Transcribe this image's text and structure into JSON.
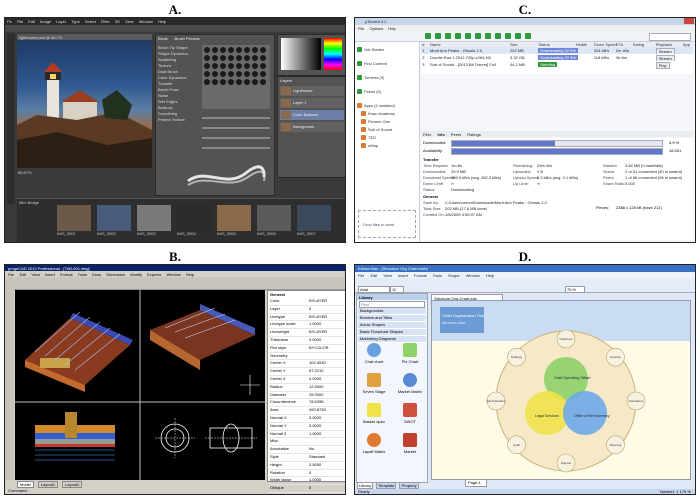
{
  "labels": {
    "a": "A.",
    "b": "B.",
    "c": "C.",
    "d": "D."
  },
  "panelA": {
    "menu": [
      "Ps",
      "File",
      "Edit",
      "Image",
      "Layer",
      "Type",
      "Select",
      "Filter",
      "3D",
      "View",
      "Window",
      "Help"
    ],
    "doc_tab": "lighthouse.psd @ 66.7%",
    "brush_tabs": [
      "Brush",
      "Brush Presets"
    ],
    "brush_options": [
      "Brush Tip Shape",
      "Shape Dynamics",
      "Scattering",
      "Texture",
      "Dual Brush",
      "Color Dynamics",
      "Transfer",
      "Brush Pose",
      "Noise",
      "Wet Edges",
      "Build-up",
      "Smoothing",
      "Protect Texture"
    ],
    "layers_title": "Layers",
    "layers": [
      "Lighthouse",
      "Layer 1",
      "Color Balance",
      "Background"
    ],
    "status": "66.67%",
    "mini_bridge": "Mini Bridge",
    "thumbs": [
      "IMG_0001",
      "IMG_0002",
      "IMG_0003",
      "IMG_0004",
      "IMG_0005",
      "IMG_0006",
      "IMG_0007"
    ]
  },
  "panelB": {
    "title": "progeCAD 2010 Professional - [TAB-001.dwg]",
    "menu": [
      "File",
      "Edit",
      "View",
      "Insert",
      "Format",
      "Tools",
      "Draw",
      "Dimension",
      "Modify",
      "Express",
      "Window",
      "Help"
    ],
    "props_title": "General",
    "props": [
      [
        "Color",
        "BYLAYER"
      ],
      [
        "Layer",
        "0"
      ],
      [
        "Linetype",
        "BYLAYER"
      ],
      [
        "Linetype scale",
        "1.0000"
      ],
      [
        "Lineweight",
        "BYLAYER"
      ],
      [
        "Thickness",
        "0.0000"
      ],
      [
        "Plot style",
        "BYCOLOR"
      ],
      [
        "Geometry",
        ""
      ],
      [
        "Center X",
        "102.4530"
      ],
      [
        "Center Y",
        "87.2210"
      ],
      [
        "Center Z",
        "0.0000"
      ],
      [
        "Radius",
        "12.5000"
      ],
      [
        "Diameter",
        "25.0000"
      ],
      [
        "Circumference",
        "78.5398"
      ],
      [
        "Area",
        "490.8739"
      ],
      [
        "Normal X",
        "0.0000"
      ],
      [
        "Normal Y",
        "0.0000"
      ],
      [
        "Normal Z",
        "1.0000"
      ],
      [
        "Misc",
        ""
      ],
      [
        "Annotative",
        "No"
      ],
      [
        "Style",
        "Standard"
      ],
      [
        "Height",
        "2.5000"
      ],
      [
        "Rotation",
        "0"
      ],
      [
        "Width factor",
        "1.0000"
      ],
      [
        "Oblique",
        "0"
      ],
      [
        "Justify",
        "Left"
      ]
    ],
    "tabs": [
      "Model",
      "Layout1",
      "Layout2"
    ],
    "command": "Command:"
  },
  "panelC": {
    "title": "µTorrent 3.2",
    "menu": [
      "File",
      "Options",
      "Help"
    ],
    "sidebar": [
      "Get Started",
      "Find Content",
      "Torrents (3)",
      "Feeds (0)",
      "Apps (4 installed)",
      "Khan Academy",
      "Pioneer One",
      "Sub of Sound",
      "TED",
      "uMap"
    ],
    "drop_text": "Drop files to send",
    "columns": [
      "#",
      "Name",
      "Size",
      "Status",
      "Health",
      "Down Speed",
      "ETA",
      "Rating",
      "Playback",
      "App"
    ],
    "torrents": [
      [
        "1",
        "Mont Ann Peaks - Ghosts 2.0",
        "202 MB",
        "Downloading 52.5%",
        "",
        "324 kB/s",
        "2m 40s",
        "",
        "Stream",
        ""
      ],
      [
        "2",
        "Doodle.Run.1.2012.720p.x264-HD",
        "3.32 GB",
        "Downloading 22.3%",
        "",
        "118 kB/s",
        "4h 8m",
        "",
        "Stream",
        ""
      ],
      [
        "3",
        "Sub of Sound - [2013 Bit Torrent] Full",
        "44.2 MB",
        "Seeding",
        "",
        "",
        "",
        "",
        "Play",
        ""
      ]
    ],
    "detail_tabs": [
      "Files",
      "Info",
      "Peers",
      "Ratings"
    ],
    "downloaded_label": "Downloaded:",
    "availability_label": "Availability:",
    "downloaded_pct": "4.9 %",
    "availability_val": "16.001",
    "transfer_title": "Transfer",
    "transfer_left": [
      [
        "Time Elapsed:",
        "1m 8s"
      ],
      [
        "Downloaded:",
        "29.9 MB"
      ],
      [
        "Download Speed:",
        "386.9 kB/s (avg. 282.3 kB/s)"
      ],
      [
        "Down Limit:",
        "∞"
      ],
      [
        "Status:",
        "Downloading"
      ]
    ],
    "transfer_mid": [
      [
        "Remaining:",
        "29m 40s"
      ],
      [
        "Uploaded:",
        "0 B"
      ],
      [
        "Upload Speed:",
        "0.3 kB/s (avg. 0.1 kB/s)"
      ],
      [
        "Up Limit:",
        "∞"
      ]
    ],
    "transfer_right": [
      [
        "Wasted:",
        "3.84 MB (0 hashfails)"
      ],
      [
        "Seeds:",
        "2 of 51 connected (40 in swarm)"
      ],
      [
        "Peers:",
        "1 of 86 connected (96 in swarm)"
      ],
      [
        "Share Ratio:",
        "0.000"
      ]
    ],
    "general_title": "General",
    "general_rows": [
      [
        "Save As:",
        "C:\\Users\\umum\\Downloads\\Mont Ann Peaks - Ghosts 2.0"
      ],
      [
        "Total Size:",
        "202 MB (27.6 MB done)"
      ],
      [
        "Created On:",
        "1/6/2009 3:55:07 AM"
      ]
    ],
    "pieces_label": "Pieces:",
    "pieces_val": "2388 x 128 kB (have 212)",
    "progress": {
      "downloaded": 0.49,
      "availability": 1.0
    }
  },
  "panelD": {
    "title": "Edraw Max - [Structure Org Chart.eddx]",
    "menu": [
      "File",
      "Edit",
      "View",
      "Insert",
      "Format",
      "Tools",
      "Shape",
      "Window",
      "Help"
    ],
    "font_name": "Arial",
    "font_size": "10",
    "zoom": "75 %",
    "library_title": "Library",
    "search_placeholder": "Find",
    "categories": [
      "Backgrounds",
      "Borders and Titles",
      "Arrow Shapes",
      "Basic Flowchart Shapes",
      "Marketing Diagrams"
    ],
    "shapes": [
      "Chat chart",
      "Pie Chart",
      "Seven Stage",
      "Market Matrix",
      "Basket apex",
      "SWOT",
      "Layoff Matrix",
      "Market"
    ],
    "doc_tab": "Structure-Org-Chart.edx",
    "diagram": {
      "title": "Chart Organization Tree",
      "subtitle": "Structure chart",
      "center": "Chief Operating Officer",
      "left": "Legal Services",
      "right": "Office of the Secretary",
      "satellites": [
        "Chairman",
        "Finance",
        "Operations",
        "Planning",
        "Support",
        "Audit",
        "Administration",
        "Strategy"
      ]
    },
    "page_tab": "Page-1",
    "bottom_tabs": [
      "Library",
      "Template",
      "Property"
    ],
    "status": "Ready",
    "status_right": "Number: 1  175 %"
  },
  "colors": {
    "ps_dark": "#3a3a3a",
    "ps_panel": "#535353",
    "cad_black": "#000000",
    "cad_blue": "#3060c8",
    "ut_green": "#2e9a3a",
    "ut_blue": "#6e86d8",
    "ed_blue": "#1f4e9a",
    "ed_yellow": "#fff2b8"
  }
}
